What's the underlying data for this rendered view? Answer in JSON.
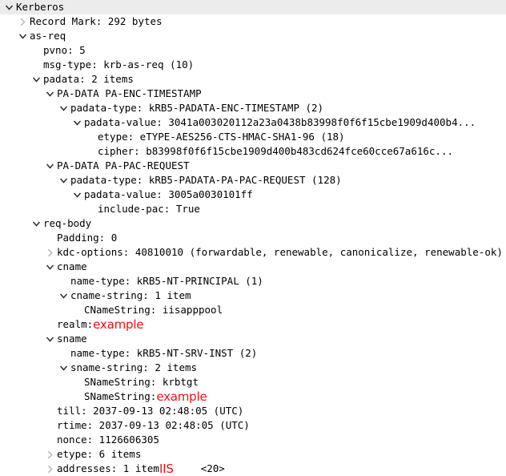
{
  "window": {
    "app": "packet-detail-tree",
    "accent_red": "#ee1111",
    "selection_bg": "#ececec",
    "text_color": "#000000",
    "chevron_open_color": "#2b2b2b",
    "chevron_closed_color": "#b9b9b9"
  },
  "tree": {
    "rows": [
      {
        "depth": 0,
        "state": "open",
        "text": "Kerberos",
        "selected": true
      },
      {
        "depth": 1,
        "state": "closed",
        "text": "Record Mark: 292 bytes"
      },
      {
        "depth": 1,
        "state": "open",
        "text": "as-req"
      },
      {
        "depth": 2,
        "state": "leaf",
        "text": "pvno: 5"
      },
      {
        "depth": 2,
        "state": "leaf",
        "text": "msg-type: krb-as-req (10)"
      },
      {
        "depth": 2,
        "state": "open",
        "text": "padata: 2 items"
      },
      {
        "depth": 3,
        "state": "open",
        "text": "PA-DATA PA-ENC-TIMESTAMP"
      },
      {
        "depth": 4,
        "state": "open",
        "text": "padata-type: kRB5-PADATA-ENC-TIMESTAMP (2)"
      },
      {
        "depth": 5,
        "state": "open",
        "text": "padata-value: 3041a003020112a23a0438b83998f0f6f15cbe1909d400b4..."
      },
      {
        "depth": 6,
        "state": "leaf",
        "text": "etype: eTYPE-AES256-CTS-HMAC-SHA1-96 (18)"
      },
      {
        "depth": 6,
        "state": "leaf",
        "text": "cipher: b83998f0f6f15cbe1909d400b483cd624fce60cce67a616c..."
      },
      {
        "depth": 3,
        "state": "open",
        "text": "PA-DATA PA-PAC-REQUEST"
      },
      {
        "depth": 4,
        "state": "open",
        "text": "padata-type: kRB5-PADATA-PA-PAC-REQUEST (128)"
      },
      {
        "depth": 5,
        "state": "open",
        "text": "padata-value: 3005a0030101ff"
      },
      {
        "depth": 6,
        "state": "leaf",
        "text": "include-pac: True"
      },
      {
        "depth": 2,
        "state": "open",
        "text": "req-body"
      },
      {
        "depth": 3,
        "state": "leaf",
        "text": "Padding: 0"
      },
      {
        "depth": 3,
        "state": "closed",
        "text": "kdc-options: 40810010 (forwardable, renewable, canonicalize, renewable-ok)"
      },
      {
        "depth": 3,
        "state": "open",
        "text": "cname"
      },
      {
        "depth": 4,
        "state": "leaf",
        "text": "name-type: kRB5-NT-PRINCIPAL (1)"
      },
      {
        "depth": 4,
        "state": "open",
        "text": "cname-string: 1 item"
      },
      {
        "depth": 5,
        "state": "leaf",
        "text": "CNameString: iisapppool"
      },
      {
        "depth": 3,
        "state": "leaf",
        "text": "realm: ",
        "red": "example"
      },
      {
        "depth": 3,
        "state": "open",
        "text": "sname"
      },
      {
        "depth": 4,
        "state": "leaf",
        "text": "name-type: kRB5-NT-SRV-INST (2)"
      },
      {
        "depth": 4,
        "state": "open",
        "text": "sname-string: 2 items"
      },
      {
        "depth": 5,
        "state": "leaf",
        "text": "SNameString: krbtgt"
      },
      {
        "depth": 5,
        "state": "leaf",
        "text": "SNameString: ",
        "red": "example"
      },
      {
        "depth": 3,
        "state": "leaf",
        "text": "till: 2037-09-13 02:48:05 (UTC)"
      },
      {
        "depth": 3,
        "state": "leaf",
        "text": "rtime: 2037-09-13 02:48:05 (UTC)"
      },
      {
        "depth": 3,
        "state": "leaf",
        "text": "nonce: 1126606305"
      },
      {
        "depth": 3,
        "state": "closed",
        "text": "etype: 6 items"
      },
      {
        "depth": 3,
        "state": "closed",
        "text": "addresses: 1 item ",
        "red": "IIS",
        "tail": "<20>"
      }
    ]
  }
}
